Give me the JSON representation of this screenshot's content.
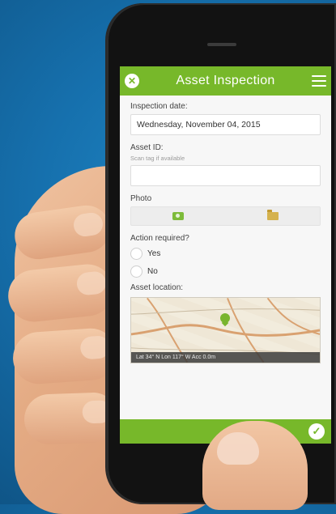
{
  "app": {
    "title": "Asset Inspection"
  },
  "form": {
    "inspection_date": {
      "label": "Inspection date:",
      "value": "Wednesday, November 04, 2015"
    },
    "asset_id": {
      "label": "Asset ID:",
      "hint": "Scan tag if available",
      "value": ""
    },
    "photo": {
      "label": "Photo"
    },
    "action_required": {
      "label": "Action required?",
      "options": [
        "Yes",
        "No"
      ]
    },
    "asset_location": {
      "label": "Asset location:",
      "coords": "Lat 34° N   Lon 117° W   Acc 0.0m"
    }
  },
  "icons": {
    "close": "close-icon",
    "menu": "hamburger-icon",
    "camera": "camera-icon",
    "folder": "folder-icon",
    "submit": "check-icon",
    "map_pin": "map-pin-icon"
  },
  "colors": {
    "accent": "#77b82a",
    "background": "#1670ad"
  }
}
